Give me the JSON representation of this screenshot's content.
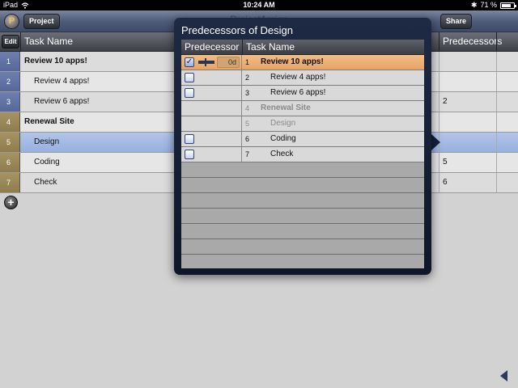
{
  "status_bar": {
    "device": "iPad",
    "time": "10:24 AM",
    "battery": "71 %"
  },
  "toolbar": {
    "project_label": "Project",
    "share_label": "Share",
    "title": "ProjectAmigo"
  },
  "table": {
    "edit_label": "Edit",
    "headers": {
      "task_name": "Task Name",
      "predecessors": "Predecessors"
    },
    "rows": [
      {
        "num": "1",
        "name": "Review 10 apps!",
        "pred": ""
      },
      {
        "num": "2",
        "name": "Review 4 apps!",
        "pred": ""
      },
      {
        "num": "3",
        "name": "Review 6 apps!",
        "pred": "2"
      },
      {
        "num": "4",
        "name": "Renewal Site",
        "pred": ""
      },
      {
        "num": "5",
        "name": "Design",
        "pred": ""
      },
      {
        "num": "6",
        "name": "Coding",
        "pred": "5"
      },
      {
        "num": "7",
        "name": "Check",
        "pred": "6"
      }
    ]
  },
  "popover": {
    "title": "Predecessors of Design",
    "headers": {
      "predecessor": "Predecessor",
      "task_name": "Task Name"
    },
    "rows": [
      {
        "num": "1",
        "name": "Review 10 apps!",
        "lag": "0d",
        "checked": true
      },
      {
        "num": "2",
        "name": "Review 4 apps!",
        "checked": false
      },
      {
        "num": "3",
        "name": "Review 6 apps!",
        "checked": false
      },
      {
        "num": "4",
        "name": "Renewal Site"
      },
      {
        "num": "5",
        "name": "Design"
      },
      {
        "num": "6",
        "name": "Coding",
        "checked": false
      },
      {
        "num": "7",
        "name": "Check",
        "checked": false
      }
    ],
    "check_mark": "✓"
  },
  "icons": {
    "app": "P",
    "add": "+"
  },
  "colors": {
    "accent_blue": "#56689b",
    "summary_olive": "#8e7c4e",
    "highlight_orange": "#e6a466",
    "selected_row": "#97b0de"
  }
}
